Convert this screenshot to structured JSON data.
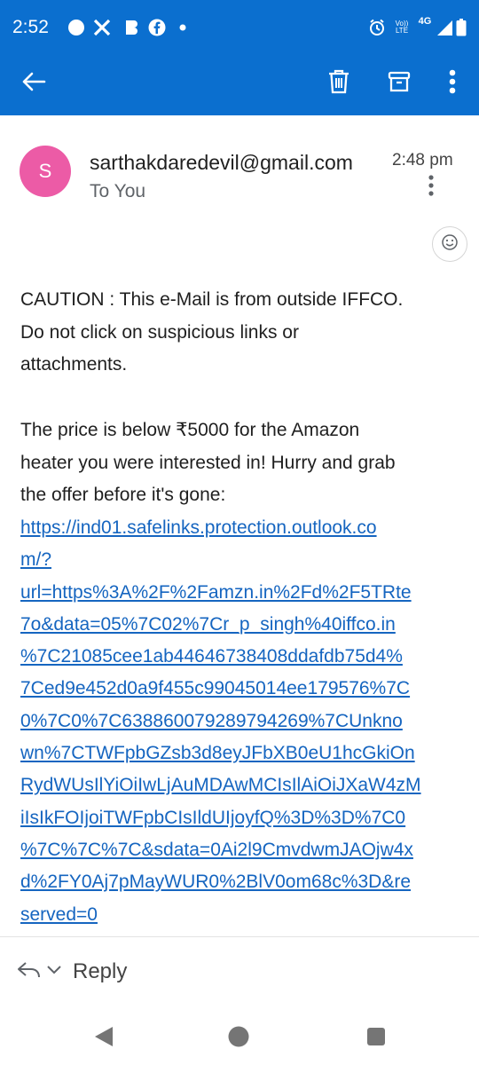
{
  "status_bar": {
    "time": "2:52",
    "network_label": "4G",
    "volte_label": "Vo)) LTE",
    "icons": [
      "notification-dot-icon",
      "x-icon",
      "b-icon",
      "facebook-icon",
      "dot-icon",
      "alarm-icon",
      "volte-icon",
      "signal-icon",
      "battery-icon"
    ]
  },
  "app_bar": {
    "back_icon": "arrow-left-icon",
    "delete_icon": "trash-icon",
    "archive_icon": "archive-icon",
    "more_icon": "more-vertical-icon",
    "background_color": "#0b6fcf"
  },
  "email": {
    "avatar_letter": "S",
    "avatar_color": "#ec5ba6",
    "sender": "sarthakdaredevil@gmail.com",
    "time": "2:48 pm",
    "recipient_line": "To You",
    "caution_lines": [
      "CAUTION : This e-Mail is from outside IFFCO.",
      "Do not click on suspicious links or",
      "attachments."
    ],
    "message_lines": [
      "The price is below ₹5000 for the Amazon",
      "heater you were interested in! Hurry and grab",
      "the offer before it's gone:"
    ],
    "link_lines": [
      "https://ind01.safelinks.protection.outlook.co",
      "m/?",
      "url=https%3A%2F%2Famzn.in%2Fd%2F5TRte",
      "7o&data=05%7C02%7Cr_p_singh%40iffco.in",
      "%7C21085cee1ab44646738408ddafdb75d4%",
      "7Ced9e452d0a9f455c99045014ee179576%7C",
      "0%7C0%7C638860079289794269%7CUnkno",
      "wn%7CTWFpbGZsb3d8eyJFbXB0eU1hcGkiOn",
      "RydWUsIlYiOiIwLjAuMDAwMCIsIlAiOiJXaW4zM",
      "iIsIkFOIjoiTWFpbCIsIldUIjoyfQ%3D%3D%7C0",
      "%7C%7C%7C&sdata=0Ai2l9CmvdwmJAOjw4x",
      "d%2FY0Aj7pMayWUR0%2BlV0om68c%3D&re",
      "served=0"
    ],
    "link_color": "#1565c0"
  },
  "reply": {
    "label": "Reply"
  },
  "nav": {
    "icons": [
      "back-triangle-icon",
      "home-circle-icon",
      "recents-square-icon"
    ]
  }
}
